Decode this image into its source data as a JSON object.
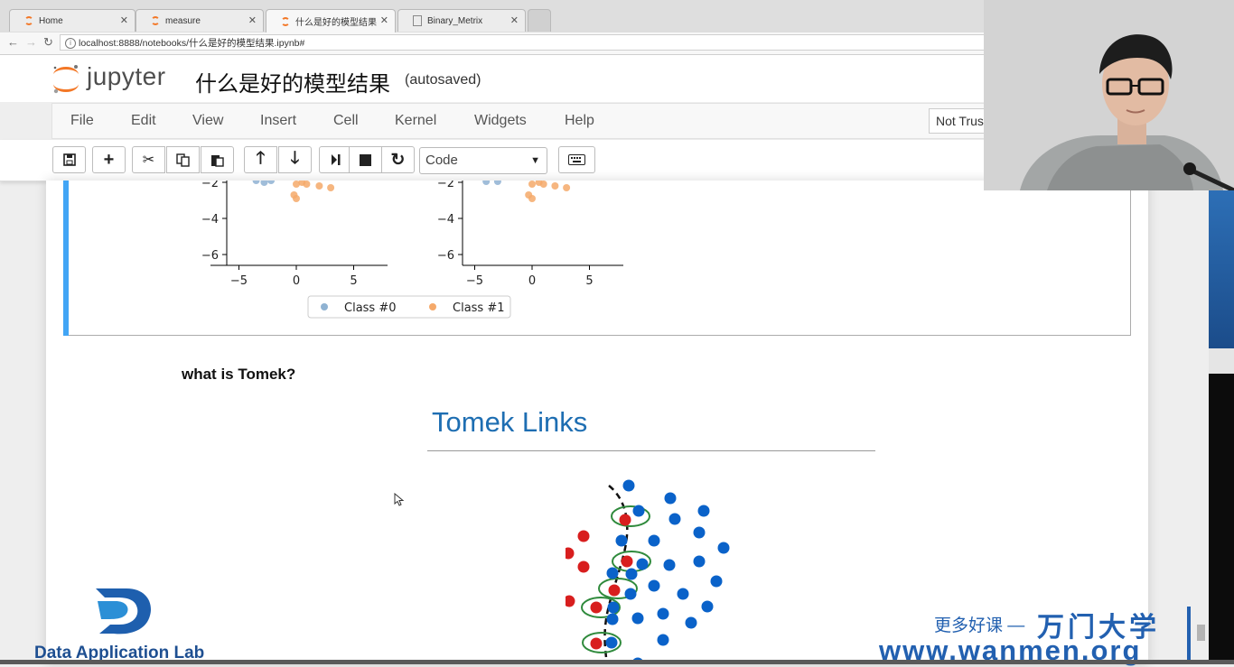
{
  "browser": {
    "tabs": [
      {
        "label": "Home",
        "active": false
      },
      {
        "label": "measure",
        "active": false
      },
      {
        "label": "什么是好的模型结果",
        "active": true
      },
      {
        "label": "Binary_Metrix",
        "active": false
      }
    ],
    "url": "localhost:8888/notebooks/什么是好的模型结果.ipynb#"
  },
  "jupyter": {
    "brand": "jupyter",
    "notebook_title": "什么是好的模型结果",
    "autosave_status": "(autosaved)",
    "menu": [
      "File",
      "Edit",
      "View",
      "Insert",
      "Cell",
      "Kernel",
      "Widgets",
      "Help"
    ],
    "trust_label": "Not Trusted",
    "cell_type": "Code",
    "toolbar_icons": [
      "save-icon",
      "plus-icon",
      "scissors-icon",
      "copy-icon",
      "paste-icon",
      "arrow-up-icon",
      "arrow-down-icon",
      "run-icon",
      "stop-icon",
      "restart-icon",
      "keyboard-icon"
    ]
  },
  "chart_data": [
    {
      "type": "scatter",
      "y_ticks": [
        "−2",
        "−4",
        "−6"
      ],
      "x_ticks": [
        "−5",
        "0",
        "5"
      ],
      "series": [
        {
          "name": "Class #0",
          "color": "#8fb2d2",
          "points": [
            [
              -3.5,
              -1.9
            ],
            [
              -2.8,
              -2.0
            ],
            [
              -2.2,
              -1.9
            ]
          ]
        },
        {
          "name": "Class #1",
          "color": "#f5a96a",
          "points": [
            [
              0,
              -2.1
            ],
            [
              0.5,
              -2.0
            ],
            [
              0.9,
              -2.1
            ],
            [
              2.0,
              -2.2
            ],
            [
              3.0,
              -2.3
            ],
            [
              -0.2,
              -2.7
            ],
            [
              0,
              -2.9
            ]
          ]
        }
      ]
    },
    {
      "type": "scatter",
      "y_ticks": [
        "−2",
        "−4",
        "−6"
      ],
      "x_ticks": [
        "−5",
        "0",
        "5"
      ],
      "series": [
        {
          "name": "Class #0",
          "color": "#8fb2d2",
          "points": [
            [
              -4.0,
              -1.95
            ],
            [
              -3.0,
              -1.95
            ]
          ]
        },
        {
          "name": "Class #1",
          "color": "#f5a96a",
          "points": [
            [
              0,
              -2.1
            ],
            [
              0.6,
              -2.0
            ],
            [
              1.0,
              -2.1
            ],
            [
              2.0,
              -2.2
            ],
            [
              3.0,
              -2.3
            ],
            [
              -0.3,
              -2.7
            ],
            [
              0,
              -2.9
            ]
          ]
        }
      ]
    }
  ],
  "legend": [
    "Class #0",
    "Class #1"
  ],
  "markdown": {
    "heading": "what is Tomek?",
    "figure_title": "Tomek Links"
  },
  "tomek_figure": {
    "blue_color": "#0a62c9",
    "red_color": "#d81e1e",
    "ring_color": "#2f8a3c"
  },
  "watermarks": {
    "lab_name": "Data Application Lab",
    "slogan": "更多好课 —",
    "brand": "万门大学",
    "site": "www.wanmen.org"
  }
}
